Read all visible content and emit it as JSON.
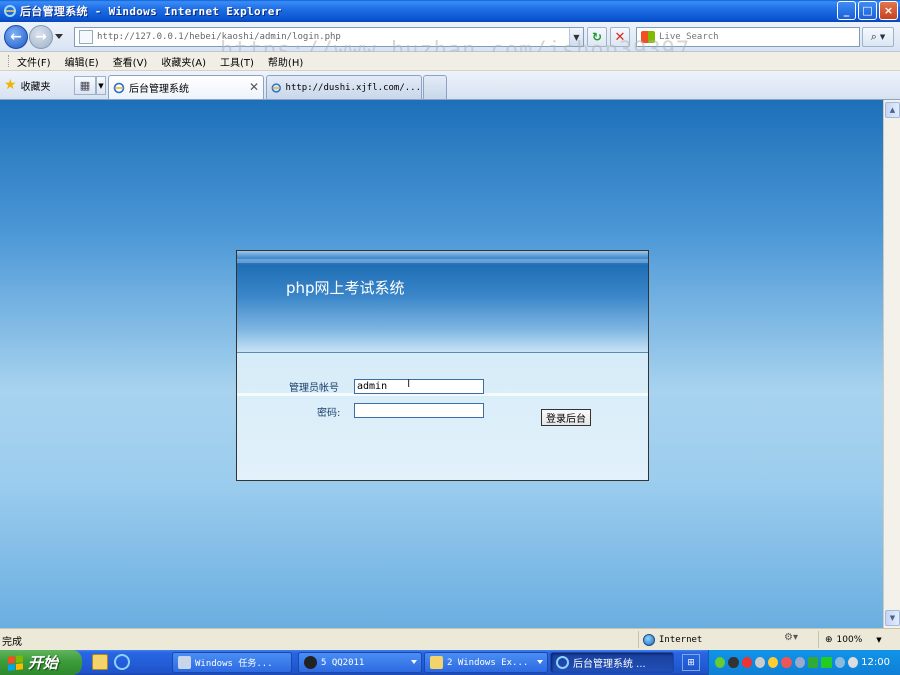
{
  "window": {
    "title": "后台管理系统 - Windows Internet Explorer",
    "controls": [
      "_",
      "□",
      "×"
    ]
  },
  "addressbar": {
    "url": "http://127.0.0.1/hebei/kaoshi/admin/login.php",
    "search_placeholder": "Live Search"
  },
  "watermark": "https://www.huzhan.com/ishop39397",
  "menu": {
    "items": [
      "文件(F)",
      "编辑(E)",
      "查看(V)",
      "收藏夹(A)",
      "工具(T)",
      "帮助(H)"
    ]
  },
  "tabs": {
    "favorites_label": "收藏夹",
    "active_title": "后台管理系统",
    "inactive_title": "http://dushi.xjfl.com/..."
  },
  "login": {
    "system_title": "php网上考试系统",
    "username_label": "管理员帐号",
    "username_value": "admin",
    "password_label": "密码:",
    "submit_label": "登录后台"
  },
  "statusbar": {
    "status_text": "完成",
    "zone_text": "Internet",
    "zoom_text": "100%"
  },
  "taskbar": {
    "start_label": "开始",
    "tasks": [
      "Windows 任务...",
      "5 QQ2011",
      "2 Windows Ex...",
      "后台管理系统 ..."
    ],
    "clock": "12:00"
  },
  "colors": {
    "titlebar": "#1f6fe6",
    "page_top": "#1d70b8",
    "page_mid": "#a8d3ef",
    "login_header": "#1f6eb5",
    "start_button": "#3c9c3b"
  }
}
